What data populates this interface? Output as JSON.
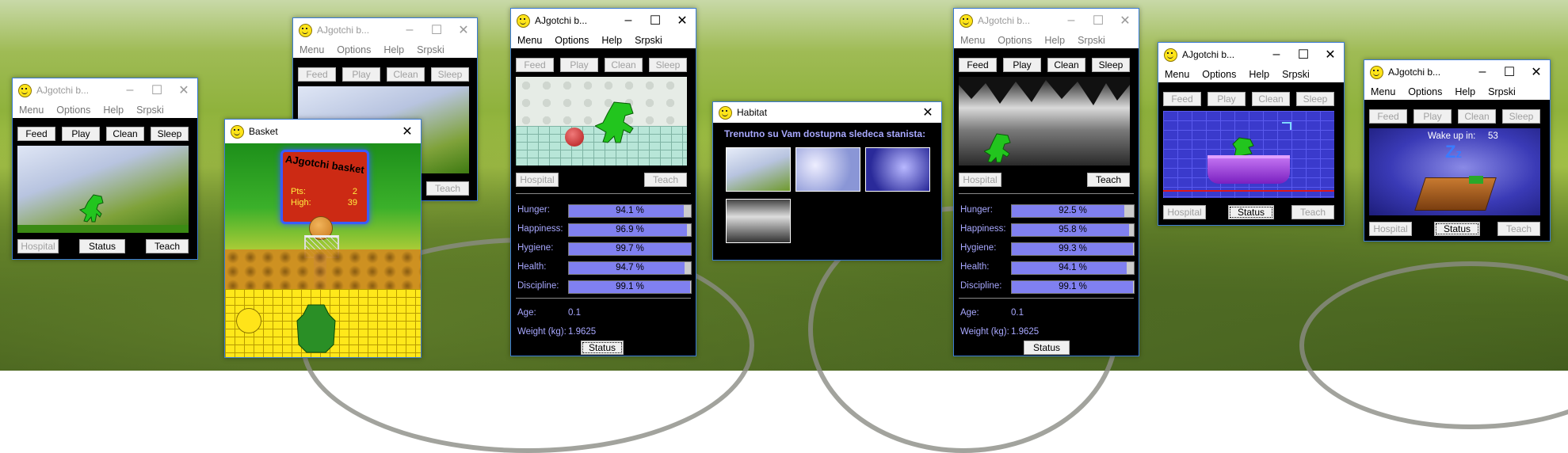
{
  "app_title": "AJgotchi b...",
  "menu": [
    "Menu",
    "Options",
    "Help",
    "Srpski"
  ],
  "buttons": {
    "feed": "Feed",
    "play": "Play",
    "clean": "Clean",
    "sleep": "Sleep",
    "hospital": "Hospital",
    "status": "Status",
    "teach": "Teach"
  },
  "basket": {
    "window_title": "Basket",
    "sign_title": "AJgotchi basket",
    "pts_label": "Pts:",
    "pts_value": "2",
    "high_label": "High:",
    "high_value": "39"
  },
  "habitat": {
    "window_title": "Habitat",
    "prompt": "Trenutno su Vam dostupna sledeca stanista:"
  },
  "status_a": {
    "rows": [
      {
        "label": "Hunger:",
        "value": "94.1 %",
        "pct": 94.1
      },
      {
        "label": "Happiness:",
        "value": "96.9 %",
        "pct": 96.9
      },
      {
        "label": "Hygiene:",
        "value": "99.7 %",
        "pct": 99.7
      },
      {
        "label": "Health:",
        "value": "94.7 %",
        "pct": 94.7
      },
      {
        "label": "Discipline:",
        "value": "99.1 %",
        "pct": 99.1
      }
    ],
    "age_label": "Age:",
    "age_value": "0.1",
    "weight_label": "Weight (kg):",
    "weight_value": "1.9625"
  },
  "status_b": {
    "rows": [
      {
        "label": "Hunger:",
        "value": "92.5 %",
        "pct": 92.5
      },
      {
        "label": "Happiness:",
        "value": "95.8 %",
        "pct": 95.8
      },
      {
        "label": "Hygiene:",
        "value": "99.3 %",
        "pct": 99.3
      },
      {
        "label": "Health:",
        "value": "94.1 %",
        "pct": 94.1
      },
      {
        "label": "Discipline:",
        "value": "99.1 %",
        "pct": 99.1
      }
    ],
    "age_label": "Age:",
    "age_value": "0.1",
    "weight_label": "Weight (kg):",
    "weight_value": "1.9625"
  },
  "sleep": {
    "wake_label": "Wake up in:",
    "wake_value": "53"
  },
  "colors": {
    "accent": "#3a7bd5",
    "bar_fill": "#8080f0",
    "label_blue": "#a8a8ff",
    "dino_green": "#22c51e"
  }
}
